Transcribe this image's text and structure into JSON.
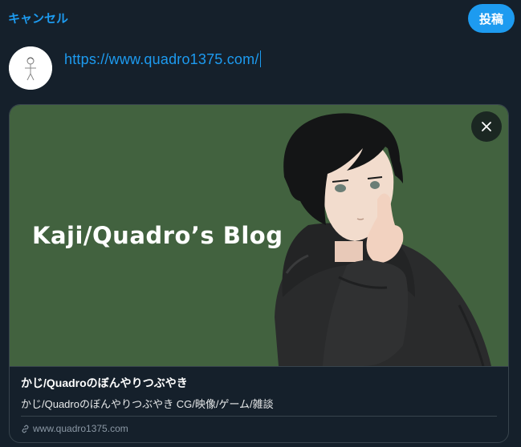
{
  "header": {
    "cancel_label": "キャンセル",
    "post_label": "投稿"
  },
  "compose": {
    "text": "https://www.quadro1375.com/"
  },
  "link_card": {
    "banner_text": "Kaji/Quadro’s Blog",
    "title": "かじ/Quadroのぼんやりつぶやき",
    "description": "かじ/Quadroのぼんやりつぶやき CG/映像/ゲーム/雑談",
    "domain": "www.quadro1375.com",
    "banner_color": "#42623f"
  },
  "colors": {
    "background": "#15202b",
    "accent": "#1d9bf0",
    "border": "#38444d"
  },
  "icons": {
    "close": "close-icon",
    "link": "link-icon"
  }
}
